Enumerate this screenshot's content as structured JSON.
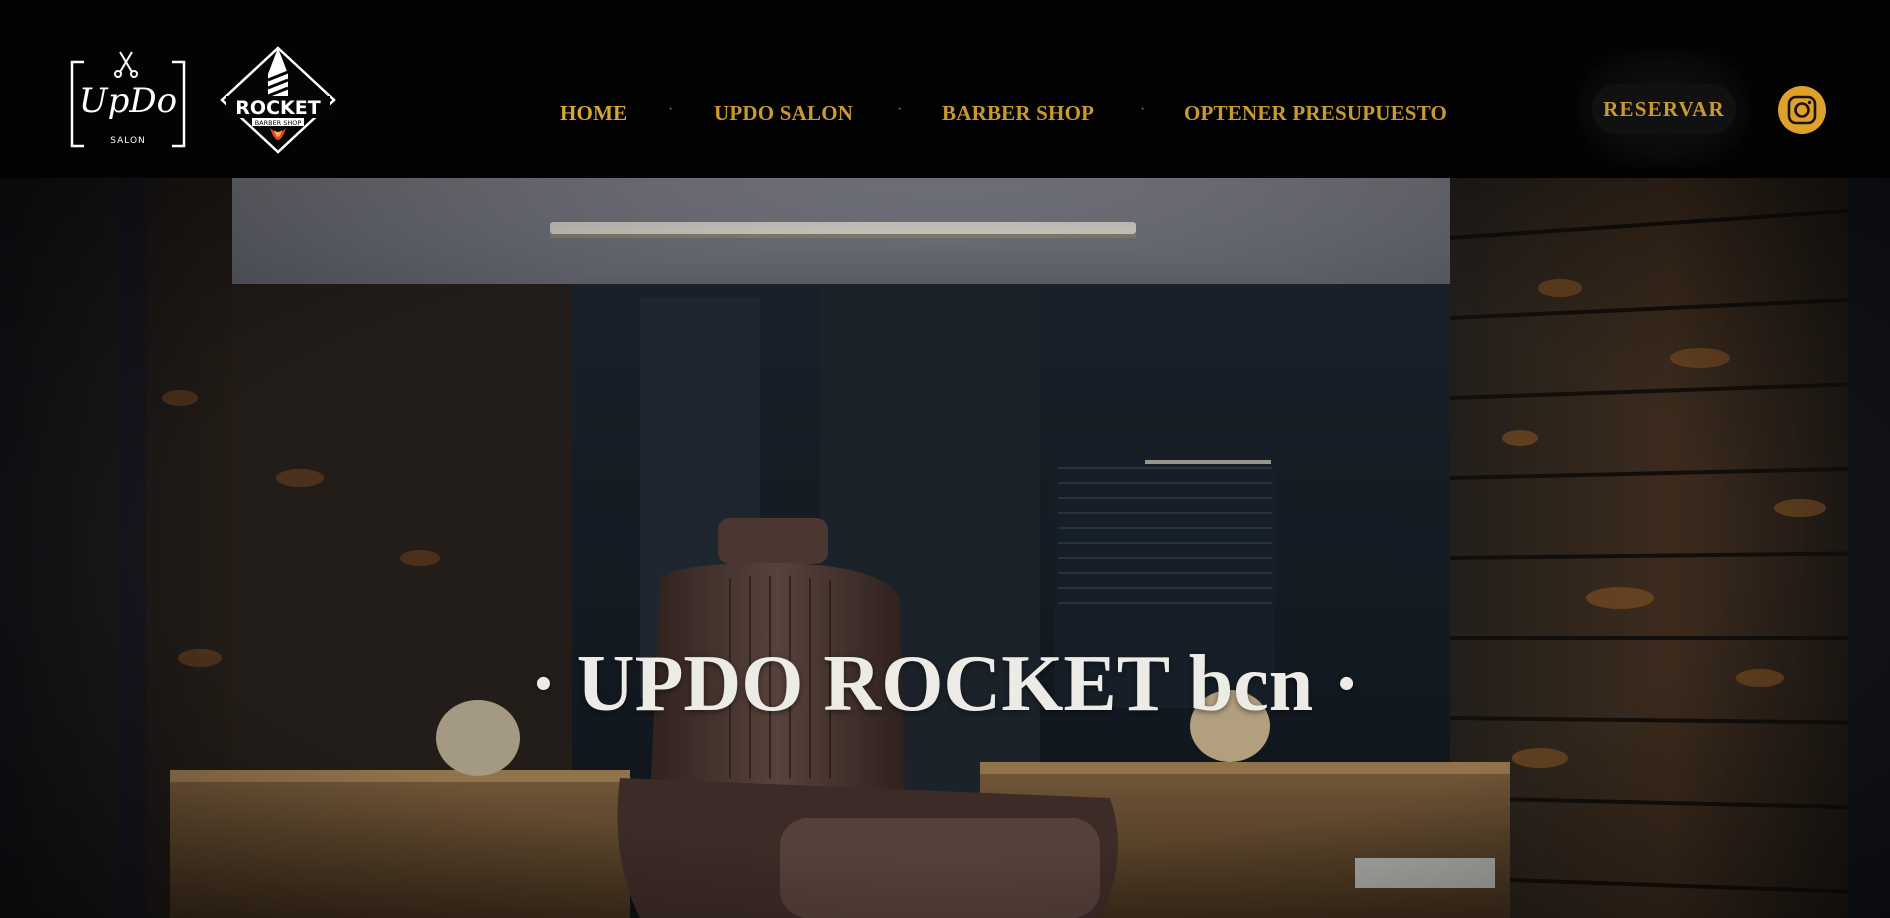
{
  "header": {
    "logos": {
      "updo": {
        "text": "UpDo",
        "subtext": "SALON"
      },
      "rocket": {
        "text": "ROCKET",
        "subtext": "BARBER SHOP"
      }
    },
    "nav": [
      {
        "label": "HOME",
        "active": true
      },
      {
        "label": "UPDO SALON",
        "active": false
      },
      {
        "label": "BARBER SHOP",
        "active": false
      },
      {
        "label": "OPTENER PRESUPUESTO",
        "active": false
      }
    ],
    "nav_separator": "·",
    "reserve_label": "RESERVAR",
    "social": {
      "icon": "instagram-icon"
    }
  },
  "hero": {
    "title": "· UPDO ROCKET bcn ·"
  },
  "colors": {
    "header_bg": "#030303",
    "accent_gold": "#c99a2e",
    "instagram_bg": "#e0a12a",
    "hero_title": "#ecebe6"
  }
}
